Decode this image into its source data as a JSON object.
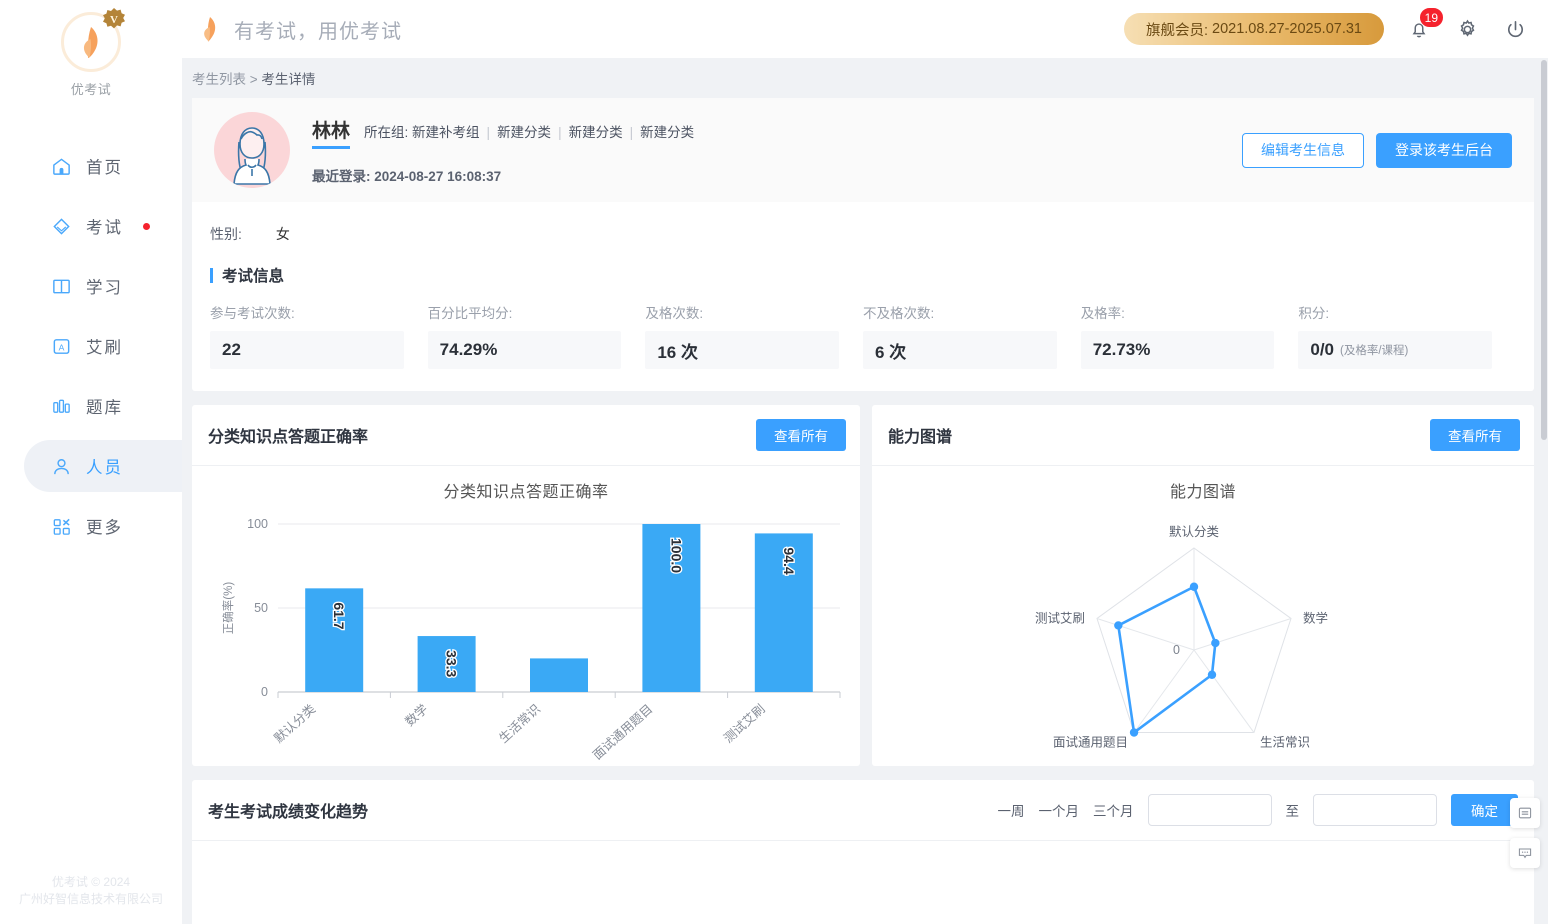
{
  "app": {
    "brand_name": "优考试",
    "brand_slogan": "有考试，用优考试",
    "copyright_line1": "优考试 © 2024",
    "copyright_line2": "广州好智信息技术有限公司"
  },
  "topbar": {
    "vip_label": "旗舰会员:",
    "vip_range": "2021.08.27-2025.07.31",
    "notification_count": "19",
    "icons": [
      "bell-icon",
      "gear-icon",
      "power-icon"
    ]
  },
  "sidebar": {
    "items": [
      {
        "label": "首页",
        "icon": "home-icon",
        "active": false,
        "dot": false
      },
      {
        "label": "考试",
        "icon": "exam-icon",
        "active": false,
        "dot": true
      },
      {
        "label": "学习",
        "icon": "book-icon",
        "active": false,
        "dot": false
      },
      {
        "label": "艾刷",
        "icon": "letter-a-icon",
        "active": false,
        "dot": false
      },
      {
        "label": "题库",
        "icon": "bars-icon",
        "active": false,
        "dot": false
      },
      {
        "label": "人员",
        "icon": "user-icon",
        "active": true,
        "dot": false
      },
      {
        "label": "更多",
        "icon": "grid-more-icon",
        "active": false,
        "dot": false
      }
    ]
  },
  "breadcrumb": {
    "parent": "考生列表",
    "separator": ">",
    "current": "考生详情"
  },
  "profile": {
    "name": "林林",
    "group_label": "所在组:",
    "groups": [
      "新建补考组",
      "新建分类",
      "新建分类",
      "新建分类"
    ],
    "last_login_label": "最近登录:",
    "last_login_value": "2024-08-27 16:08:37",
    "edit_button": "编辑考生信息",
    "login_button": "登录该考生后台",
    "gender_label": "性别:",
    "gender_value": "女"
  },
  "exam_info": {
    "section_title": "考试信息",
    "stats": [
      {
        "label": "参与考试次数:",
        "value": "22",
        "sub": ""
      },
      {
        "label": "百分比平均分:",
        "value": "74.29%",
        "sub": ""
      },
      {
        "label": "及格次数:",
        "value": "16 次",
        "sub": ""
      },
      {
        "label": "不及格次数:",
        "value": "6 次",
        "sub": ""
      },
      {
        "label": "及格率:",
        "value": "72.73%",
        "sub": ""
      },
      {
        "label": "积分:",
        "value": "0/0",
        "sub": "(及格率/课程)"
      }
    ]
  },
  "cards": {
    "bar_card_title": "分类知识点答题正确率",
    "radar_card_title": "能力图谱",
    "view_all": "查看所有"
  },
  "trend": {
    "title": "考生考试成绩变化趋势",
    "ranges": [
      "一周",
      "一个月",
      "三个月"
    ],
    "start_placeholder": "",
    "start_value": "",
    "end_placeholder": "",
    "end_value": "",
    "to_word": "至",
    "confirm_button": "确定"
  },
  "float_buttons": [
    {
      "name": "list-panel-icon"
    },
    {
      "name": "chat-bubble-icon"
    }
  ],
  "colors": {
    "accent_blue": "#3aa0ff",
    "bar_blue": "#3aa9f5",
    "vip_gold": "#e0a94c",
    "red_badge": "#f5222d"
  },
  "chart_data": [
    {
      "type": "bar",
      "title": "分类知识点答题正确率",
      "xlabel": "",
      "ylabel": "正确率(%)",
      "ylim": [
        0,
        100
      ],
      "yticks": [
        0,
        50,
        100
      ],
      "grid": true,
      "categories": [
        "默认分类",
        "数学",
        "生活常识",
        "面试通用题目",
        "测试艾刷"
      ],
      "values": [
        61.7,
        33.3,
        20.0,
        100.0,
        94.4
      ],
      "data_labels": [
        "61.7",
        "33.3",
        "",
        "100.0",
        "94.4"
      ],
      "bar_color": "#3aa9f5"
    },
    {
      "type": "radar",
      "title": "能力图谱",
      "center_tick": "0",
      "axes": [
        "默认分类",
        "数学",
        "生活常识",
        "面试通用题目",
        "测试艾刷"
      ],
      "values": [
        62,
        22,
        30,
        100,
        78
      ],
      "max": 100,
      "line_color": "#3aa0ff"
    }
  ]
}
